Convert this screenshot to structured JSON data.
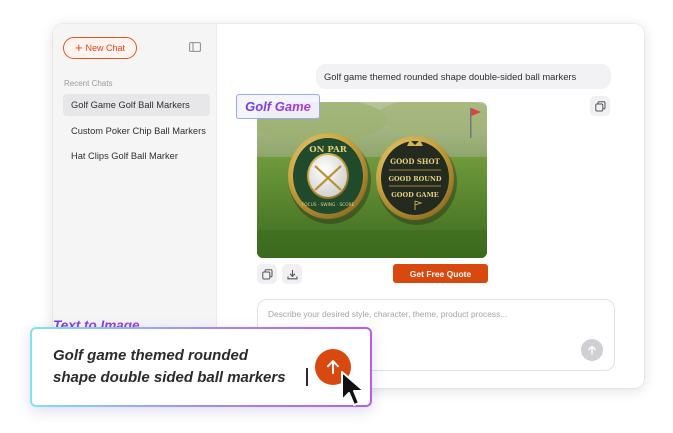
{
  "sidebar": {
    "new_chat_label": "New Chat",
    "recent_label": "Recent Chats",
    "items": [
      {
        "label": "Golf Game Golf Ball Markers",
        "active": true
      },
      {
        "label": "Custom Poker Chip Ball Markers"
      },
      {
        "label": "Hat Clips Golf Ball Marker"
      }
    ]
  },
  "chat": {
    "user_message": "Golf game themed rounded shape double-sided ball markers",
    "image_tag": "Golf Game",
    "coin_left": {
      "top": "ON PAR",
      "bottom": "FOCUS · SWING · SCORE"
    },
    "coin_right": {
      "line1": "GOOD SHOT",
      "line2": "GOOD ROUND",
      "line3": "GOOD GAME"
    },
    "quote_button": "Get Free Quote"
  },
  "prompt": {
    "placeholder": "Describe your desired style, character, theme, product process..."
  },
  "overlay": {
    "label": "Text to Image",
    "text_line1": "Golf game themed rounded",
    "text_line2": "shape double sided ball markers"
  },
  "colors": {
    "accent": "#d9480f",
    "tag_gradient_start": "#6a3fe6",
    "tag_gradient_end": "#b13ad6"
  },
  "icons": [
    "plus-icon",
    "sidebar-collapse-icon",
    "copy-icon",
    "download-icon",
    "arrow-up-icon",
    "mouse-pointer-icon"
  ]
}
